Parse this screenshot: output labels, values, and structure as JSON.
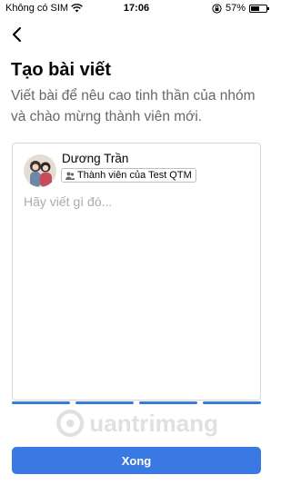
{
  "status_bar": {
    "carrier": "Không có SIM",
    "time": "17:06",
    "battery_percent": "57%",
    "battery_level": 0.57,
    "wifi_icon": "wifi-icon",
    "lock_icon": "orientation-lock-icon"
  },
  "nav": {
    "back_icon": "chevron-left-icon"
  },
  "header": {
    "title": "Tạo bài viết",
    "subtitle": "Viết bài để nêu cao tinh thần của nhóm và chào mừng thành viên mới."
  },
  "composer": {
    "author_name": "Dương Trần",
    "member_badge": "Thành viên của Test QTM",
    "placeholder": "Hãy viết gì đó..."
  },
  "watermark": {
    "text": "uantrimang"
  },
  "footer": {
    "done_label": "Xong"
  },
  "colors": {
    "accent": "#3a78e3",
    "subtitle": "#65676b",
    "border": "#d5d7db"
  }
}
